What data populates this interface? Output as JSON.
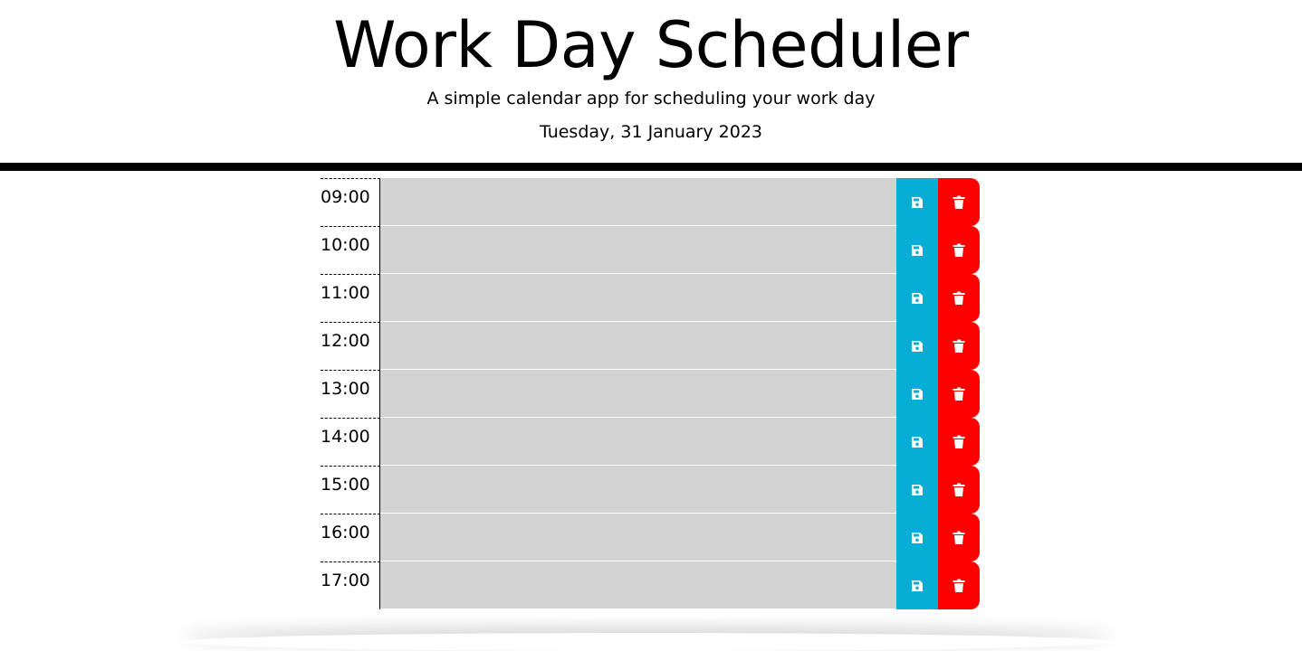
{
  "header": {
    "title": "Work Day Scheduler",
    "subtitle": "A simple calendar app for scheduling your work day",
    "current_day": "Tuesday, 31 January 2023"
  },
  "colors": {
    "past": "#d3d3d3",
    "save": "#06aed5",
    "delete": "#ff0000",
    "header_border": "#000000"
  },
  "icons": {
    "save": "floppy-disk-icon",
    "delete": "trash-icon"
  },
  "time_blocks": [
    {
      "hour": "09:00",
      "description": ""
    },
    {
      "hour": "10:00",
      "description": ""
    },
    {
      "hour": "11:00",
      "description": ""
    },
    {
      "hour": "12:00",
      "description": ""
    },
    {
      "hour": "13:00",
      "description": ""
    },
    {
      "hour": "14:00",
      "description": ""
    },
    {
      "hour": "15:00",
      "description": ""
    },
    {
      "hour": "16:00",
      "description": ""
    },
    {
      "hour": "17:00",
      "description": ""
    }
  ]
}
